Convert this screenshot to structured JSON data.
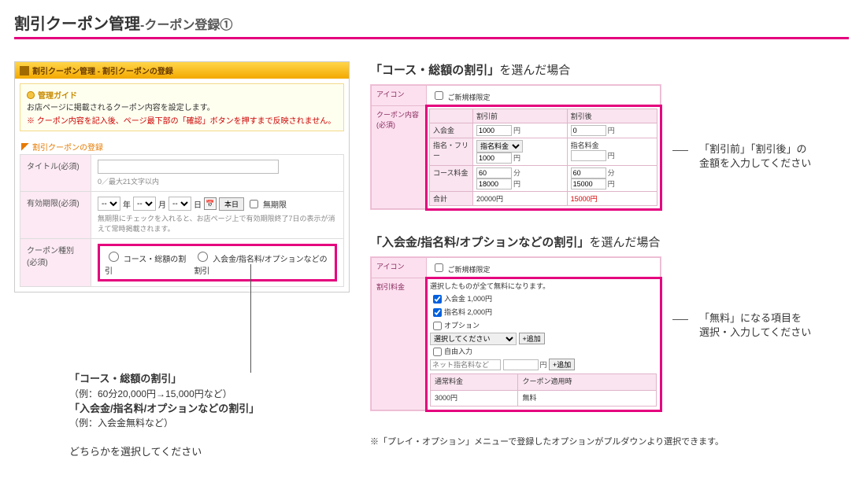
{
  "title_main": "割引クーポン管理",
  "title_sub": "-クーポン登録①",
  "admin": {
    "header": "割引クーポン管理 - 割引クーポンの登録",
    "guide_title": "管理ガイド",
    "guide_line1": "お店ページに掲載されるクーポン内容を設定します。",
    "guide_line2": "※ クーポン内容を記入後、ページ最下部の「確認」ボタンを押すまで反映されません。",
    "section_title": "割引クーポンの登録",
    "row_title": "タイトル(必須)",
    "title_counter": "0／最大21文字以内",
    "row_expire": "有効期限(必須)",
    "year_unit": "年",
    "month_unit": "月",
    "day_unit": "日",
    "btn_today": "本日",
    "chk_noexpire": "無期限",
    "expire_note": "無期限にチェックを入れると、お店ページ上で有効期限終了7日の表示が消えて常時掲載されます。",
    "row_type": "クーポン種別(必須)",
    "type_opt1": "コース・総額の割引",
    "type_opt2": "入会金/指名料/オプションなどの割引"
  },
  "left_annot": {
    "head1": "「コース・総額の割引」",
    "ex1": "（例：60分20,000円→15,000円など）",
    "head2": "「入会金/指名料/オプションなどの割引」",
    "ex2": "（例：入会金無料など）",
    "pick": "どちらかを選択してください"
  },
  "case1": {
    "title_b": "「コース・総額の割引」",
    "title_rest": "を選んだ場合",
    "lab_icon": "アイコン",
    "chk_limit": "ご新規様限定",
    "lab_content": "クーポン内容(必須)",
    "col_before": "割引前",
    "col_after": "割引後",
    "row_admission": "入会金",
    "row_nominate": "指名・フリー",
    "nominate_sel": "指名料金",
    "nominate_after_label": "指名料金",
    "row_course": "コース料金",
    "row_total": "合計",
    "yen": "円",
    "min": "分",
    "v_adm_before": "1000",
    "v_adm_after": "0",
    "v_nom_before": "1000",
    "v_nom_after": "",
    "v_course_min_before": "60",
    "v_course_min_after": "60",
    "v_course_yen_before": "18000",
    "v_course_yen_after": "15000",
    "v_total_before": "20000円",
    "v_total_after": "15000円",
    "note_l1": "「割引前」「割引後」の",
    "note_l2": "金額を入力してください"
  },
  "case2": {
    "title_b": "「入会金/指名料/オプションなどの割引」",
    "title_rest": "を選んだ場合",
    "lab_icon": "アイコン",
    "chk_limit": "ご新規様限定",
    "lab_content": "割引料金",
    "lead": "選択したものが全て無料になります。",
    "chk_adm": "入会金 1,000円",
    "chk_nom": "指名料 2,000円",
    "chk_opt": "オプション",
    "opt_placeholder": "選択してください",
    "btn_add": "+追加",
    "chk_free": "自由入力",
    "free_placeholder": "ネット指名料など",
    "yen": "円",
    "sum_norm_h": "通常料金",
    "sum_apply_h": "クーポン適用時",
    "sum_norm_v": "3000円",
    "sum_apply_v": "無料",
    "note_l1": "「無料」になる項目を",
    "note_l2": "選択・入力してください",
    "footnote": "※「プレイ・オプション」メニューで登録したオプションがプルダウンより選択できます。"
  }
}
